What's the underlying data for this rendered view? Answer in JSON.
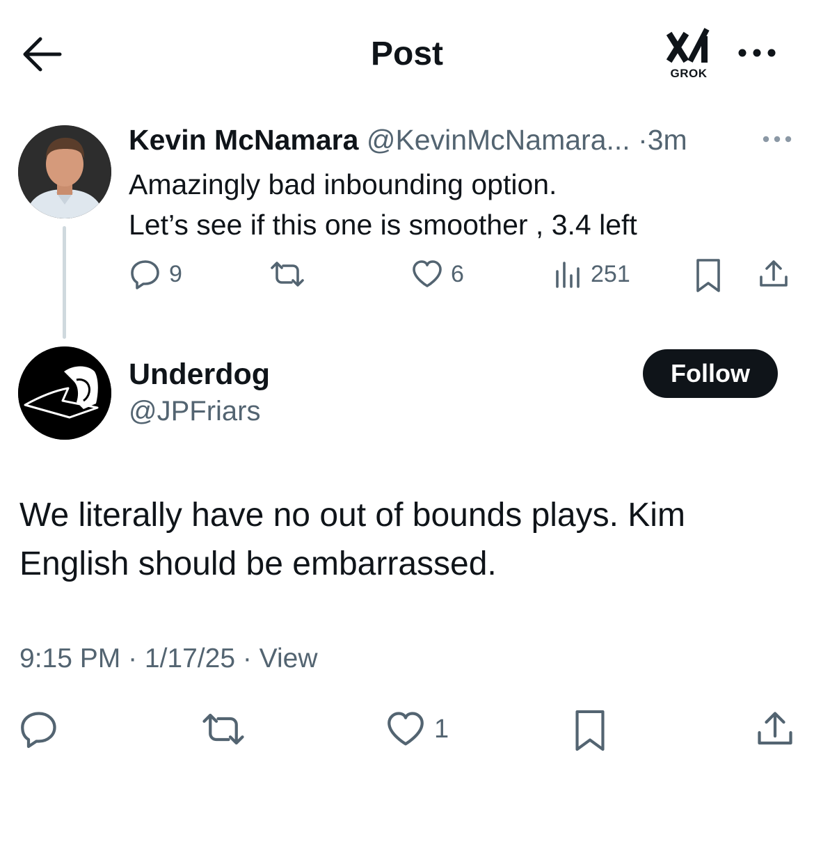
{
  "header": {
    "title": "Post",
    "grok_label": "GROK"
  },
  "parent_tweet": {
    "author_name": "Kevin McNamara",
    "author_handle": "@KevinMcNamara...",
    "time": "·3m",
    "text_line1": "Amazingly bad inbounding option.",
    "text_line2": "Let’s see if this one is smoother , 3.4 left",
    "stats": {
      "replies": "9",
      "likes": "6",
      "views": "251"
    }
  },
  "main_tweet": {
    "author_name": "Underdog",
    "author_handle": "@JPFriars",
    "follow_label": "Follow",
    "text": "We literally have no out of bounds plays. Kim English should be embarrassed.",
    "meta": "9:15 PM · 1/17/25 · View",
    "stats": {
      "likes": "1"
    }
  },
  "colors": {
    "text": "#0f1419",
    "secondary": "#536471",
    "thread_line": "#cfd9de",
    "button_bg": "#0f1419"
  }
}
